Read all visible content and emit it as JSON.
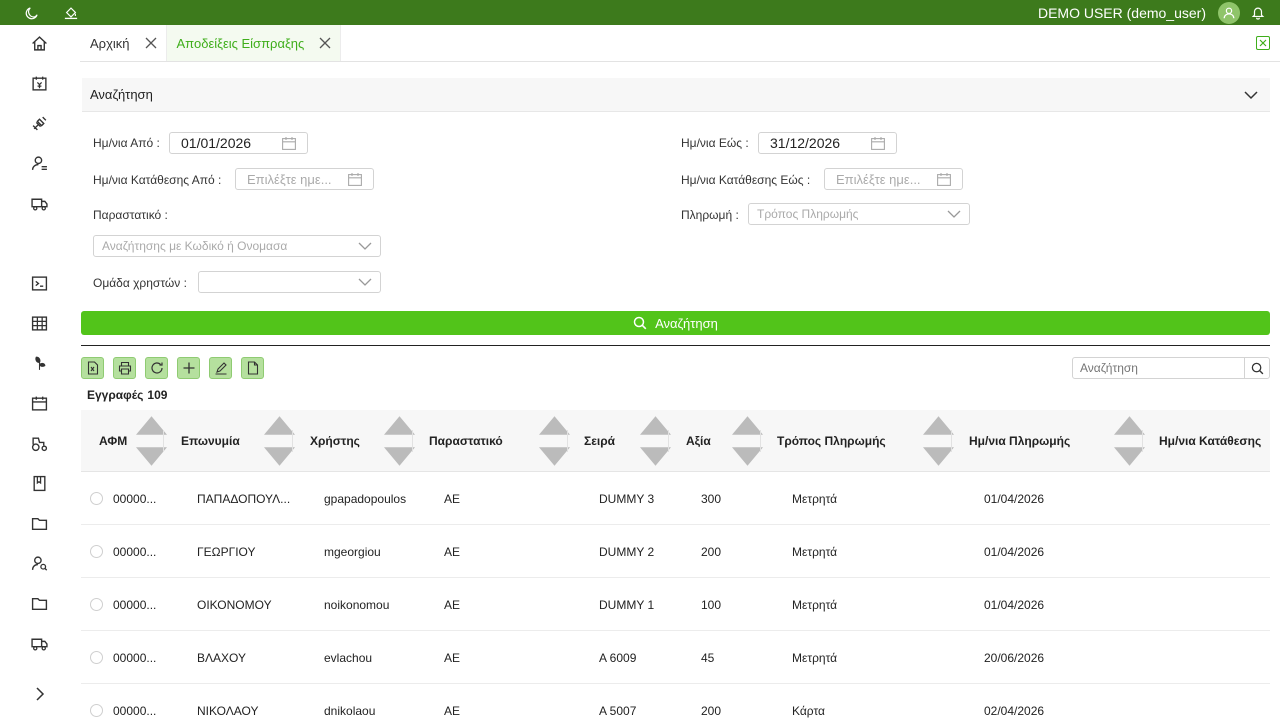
{
  "topbar": {
    "user": "DEMO USER (demo_user)"
  },
  "tabs": [
    {
      "label": "Αρχική",
      "active": false
    },
    {
      "label": "Αποδείξεις Είσπραξης",
      "active": true
    }
  ],
  "search": {
    "panel_title": "Αναζήτηση",
    "date_from_label": "Ημ/νια Από :",
    "date_from_value": "01/01/2026",
    "date_to_label": "Ημ/νια Εώς :",
    "date_to_value": "31/12/2026",
    "deposit_from_label": "Ημ/νια Κατάθεσης Από :",
    "deposit_from_placeholder": "Επιλέξτε ημε...",
    "deposit_to_label": "Ημ/νια Κατάθεσης Εώς :",
    "deposit_to_placeholder": "Επιλέξτε ημε...",
    "document_label": "Παραστατικό :",
    "document_placeholder": "Αναζήτησης με Κωδικό ή Ονομασα",
    "payment_label": "Πληρωμή :",
    "payment_placeholder": "Τρόπος Πληρωμής",
    "group_label": "Ομάδα χρηστών :",
    "search_button": "Αναζήτηση"
  },
  "grid": {
    "records_label": "Εγγραφές",
    "records_count": "109",
    "search_placeholder": "Αναζήτηση",
    "columns": [
      "ΑΦΜ",
      "Επωνυμία",
      "Χρήστης",
      "Παραστατικό",
      "Σειρά",
      "Αξία",
      "Τρόπος Πληρωμής",
      "Ημ/νια Πληρωμής",
      "Ημ/νια Κατάθεσης"
    ],
    "rows": [
      {
        "afm": "00000...",
        "name": "ΠΑΠΑΔΟΠΟΥΛ...",
        "user": "gpapadopoulos",
        "doc": "ΑΕ",
        "series": "DUMMY 3",
        "amount": "300",
        "payment": "Μετρητά",
        "date": "01/04/2026"
      },
      {
        "afm": "00000...",
        "name": "ΓΕΩΡΓΙΟΥ",
        "user": "mgeorgiou",
        "doc": "ΑΕ",
        "series": "DUMMY 2",
        "amount": "200",
        "payment": "Μετρητά",
        "date": "01/04/2026"
      },
      {
        "afm": "00000...",
        "name": "ΟΙΚΟΝΟΜΟΥ",
        "user": "noikonomou",
        "doc": "ΑΕ",
        "series": "DUMMY 1",
        "amount": "100",
        "payment": "Μετρητά",
        "date": "01/04/2026"
      },
      {
        "afm": "00000...",
        "name": "ΒΛΑΧΟΥ",
        "user": "evlachou",
        "doc": "ΑΕ",
        "series": "Α 6009",
        "amount": "45",
        "payment": "Μετρητά",
        "date": "20/06/2026"
      },
      {
        "afm": "00000...",
        "name": "ΝΙΚΟΛΑΟΥ",
        "user": "dnikolaou",
        "doc": "ΑΕ",
        "series": "Α 5007",
        "amount": "200",
        "payment": "Κάρτα",
        "date": "02/04/2026"
      }
    ]
  },
  "colors": {
    "topbar": "#3d7a1c",
    "accent": "#52c41a",
    "tab_active": "#3fae1b",
    "tool_button": "#b5e09e"
  },
  "icons": {
    "topbar": [
      "moon-icon",
      "paint-bucket-icon",
      "avatar-icon",
      "bell-icon"
    ],
    "sidebar": [
      "home-icon",
      "yen-calendar-icon",
      "satellite-icon",
      "user-list-icon",
      "truck-icon",
      "terminal-icon",
      "table-icon",
      "leaf-icon",
      "calendar-icon",
      "tractor-icon",
      "book-icon",
      "folder-icon",
      "user-search-icon",
      "folder-icon",
      "truck-icon",
      "chevron-right-icon"
    ],
    "toolbar": [
      "excel-icon",
      "print-icon",
      "refresh-icon",
      "add-icon",
      "edit-icon",
      "document-icon"
    ]
  }
}
